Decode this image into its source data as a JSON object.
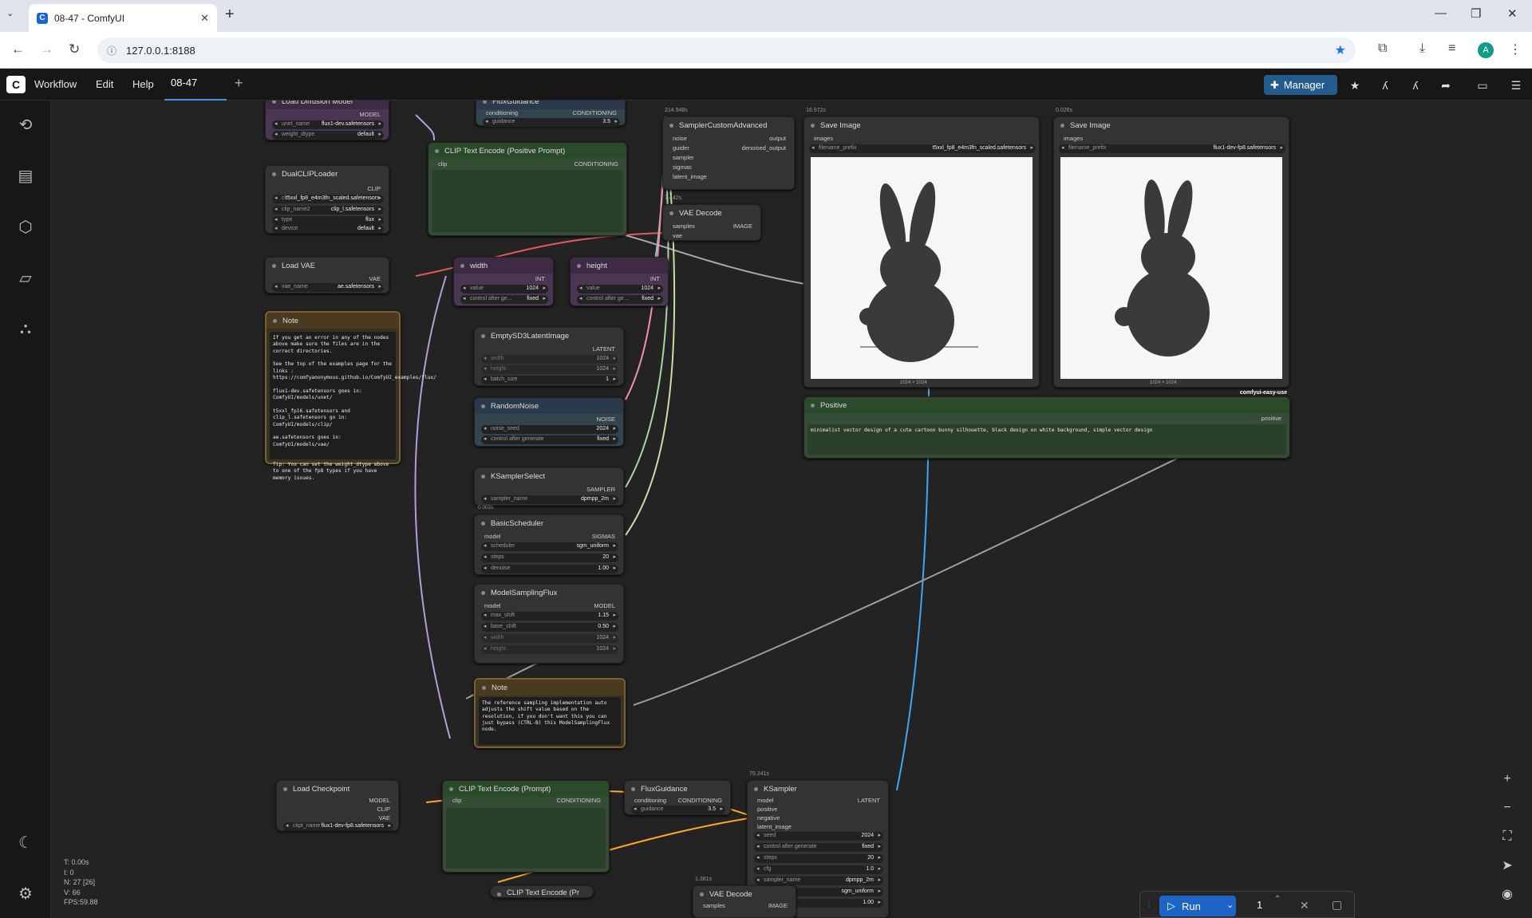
{
  "browser": {
    "tab_title": "08-47 - ComfyUI",
    "url": "127.0.0.1:8188",
    "profile_initial": "A"
  },
  "menu": {
    "workflow": "Workflow",
    "edit": "Edit",
    "help": "Help",
    "workflow_tab": "08-47",
    "manager": "Manager"
  },
  "nodes": {
    "load_diffusion": {
      "title": "Load Diffusion Model",
      "out": "MODEL",
      "unet_label": "unet_name",
      "unet_value": "flux1-dev.safetensors",
      "dtype_label": "weight_dtype",
      "dtype_value": "default"
    },
    "dualclip": {
      "title": "DualCLIPLoader",
      "out": "CLIP",
      "c1_label": "cl",
      "c1_value": "t5xxl_fp8_e4m3fn_scaled.safetensors",
      "c2_label": "clip_name2",
      "c2_value": "clip_l.safetensors",
      "type_label": "type",
      "type_value": "flux",
      "device_label": "device",
      "device_value": "default"
    },
    "load_vae": {
      "title": "Load VAE",
      "out": "VAE",
      "vae_label": "vae_name",
      "vae_value": "ae.safetensors"
    },
    "note1": {
      "title": "Note",
      "text": "If you get an error in any of the nodes above make sure the files are in the correct directories.\n\nSee the top of the examples page for the links : https://comfyanonymous.github.io/ComfyUI_examples/flux/\n\nflux1-dev.safetensors goes in: ComfyUI/models/unet/\n\nt5xxl_fp16.safetensors and clip_l.safetensors go in: ComfyUI/models/clip/\n\nae.safetensors goes in: ComfyUI/models/vae/\n\n\nTip: You can set the weight_dtype above to one of the fp8 types if you have memory issues."
    },
    "flux_guidance_top": {
      "title": "FluxGuidance",
      "in": "conditioning",
      "out": "CONDITIONING",
      "g_label": "guidance",
      "g_value": "3.5"
    },
    "clip_pos": {
      "title": "CLIP Text Encode (Positive Prompt)",
      "in": "clip",
      "out": "CONDITIONING"
    },
    "width": {
      "title": "width",
      "out": "INT",
      "v_label": "value",
      "v_value": "1024",
      "c_label": "control after ge...",
      "c_value": "fixed"
    },
    "height": {
      "title": "height",
      "out": "INT",
      "v_label": "value",
      "v_value": "1024",
      "c_label": "control after ge...",
      "c_value": "fixed"
    },
    "empty_latent": {
      "title": "EmptySD3LatentImage",
      "out": "LATENT",
      "w_label": "width",
      "w_value": "1024",
      "h_label": "height",
      "h_value": "1024",
      "b_label": "batch_size",
      "b_value": "1"
    },
    "random_noise": {
      "title": "RandomNoise",
      "out": "NOISE",
      "s_label": "noise_seed",
      "s_value": "2024",
      "c_label": "control after generate",
      "c_value": "fixed"
    },
    "ksampler_select": {
      "title": "KSamplerSelect",
      "out": "SAMPLER",
      "s_label": "sampler_name",
      "s_value": "dpmpp_2m",
      "time": "0.002s"
    },
    "basic_scheduler": {
      "title": "BasicScheduler",
      "in": "model",
      "out": "SIGMAS",
      "sch_label": "scheduler",
      "sch_value": "sgm_uniform",
      "steps_label": "steps",
      "steps_value": "20",
      "den_label": "denoise",
      "den_value": "1.00"
    },
    "model_sampling": {
      "title": "ModelSamplingFlux",
      "in": "model",
      "out": "MODEL",
      "max_label": "max_shift",
      "max_value": "1.15",
      "base_label": "base_shift",
      "base_value": "0.50",
      "w_label": "width",
      "w_value": "1024",
      "h_label": "height",
      "h_value": "1024"
    },
    "note2": {
      "title": "Note",
      "text": "The reference sampling implementation auto adjusts the shift value based on the resolution, if you don't want this you can just bypass (CTRL-B) this ModelSamplingFlux node."
    },
    "sampler_custom": {
      "title": "SamplerCustomAdvanced",
      "time": "214.948s",
      "i1": "noise",
      "i2": "guider",
      "i3": "sampler",
      "i4": "sigmas",
      "i5": "latent_image",
      "o1": "output",
      "o2": "denoised_output"
    },
    "vae_decode_top": {
      "title": "VAE Decode",
      "time": "7.442s",
      "i1": "samples",
      "i2": "vae",
      "out": "IMAGE"
    },
    "save1": {
      "title": "Save Image",
      "time": "16.972s",
      "in": "images",
      "p_label": "filename_prefix",
      "p_value": "t5xxl_fp8_e4m3fn_scaled.safetensors",
      "dims": "1024 × 1024"
    },
    "save2": {
      "title": "Save Image",
      "time": "0.026s",
      "in": "images",
      "p_label": "filename_prefix",
      "p_value": "flux1-dev-fp8.safetensors",
      "dims": "1024 × 1024",
      "tag": "comfyui-easy-use"
    },
    "positive": {
      "title": "Positive",
      "out": "positive",
      "text": "minimalist vector design of a cute cartoon bunny silhouette, black design on white background, simple vector design"
    },
    "load_ckpt": {
      "title": "Load Checkpoint",
      "o1": "MODEL",
      "o2": "CLIP",
      "o3": "VAE",
      "c_label": "ckpt_name",
      "c_value": "flux1-dev-fp8.safetensors"
    },
    "clip_bottom": {
      "title": "CLIP Text Encode (Prompt)",
      "in": "clip",
      "out": "CONDITIONING"
    },
    "clip_collapsed": {
      "title": "CLIP Text Encode (Pr"
    },
    "flux_guidance_bottom": {
      "title": "FluxGuidance",
      "in": "conditioning",
      "out": "CONDITIONING",
      "g_label": "guidance",
      "g_value": "3.5"
    },
    "ksampler": {
      "title": "KSampler",
      "time": "79.241s",
      "i1": "model",
      "i2": "positive",
      "i3": "negative",
      "i4": "latent_image",
      "out": "LATENT",
      "seed_label": "seed",
      "seed_value": "2024",
      "ctrl_label": "control after generate",
      "ctrl_value": "fixed",
      "steps_label": "steps",
      "steps_value": "20",
      "cfg_label": "cfg",
      "cfg_value": "1.0",
      "sampler_label": "sampler_name",
      "sampler_value": "dpmpp_2m",
      "sched_label": "scheduler",
      "sched_value": "sgm_uniform",
      "den_label": "denoise",
      "den_value": "1.00"
    },
    "vae_decode_bottom": {
      "title": "VAE Decode",
      "time": "1.381s",
      "i1": "samples",
      "out": "IMAGE"
    }
  },
  "stats": {
    "t": "T: 0.00s",
    "i": "I: 0",
    "n": "N: 27 [26]",
    "v": "V: 66",
    "fps": "FPS:59.88"
  },
  "run": {
    "label": "Run",
    "count": "1"
  },
  "colors": {
    "accent": "#1d64c7",
    "manager": "#245b8d"
  }
}
